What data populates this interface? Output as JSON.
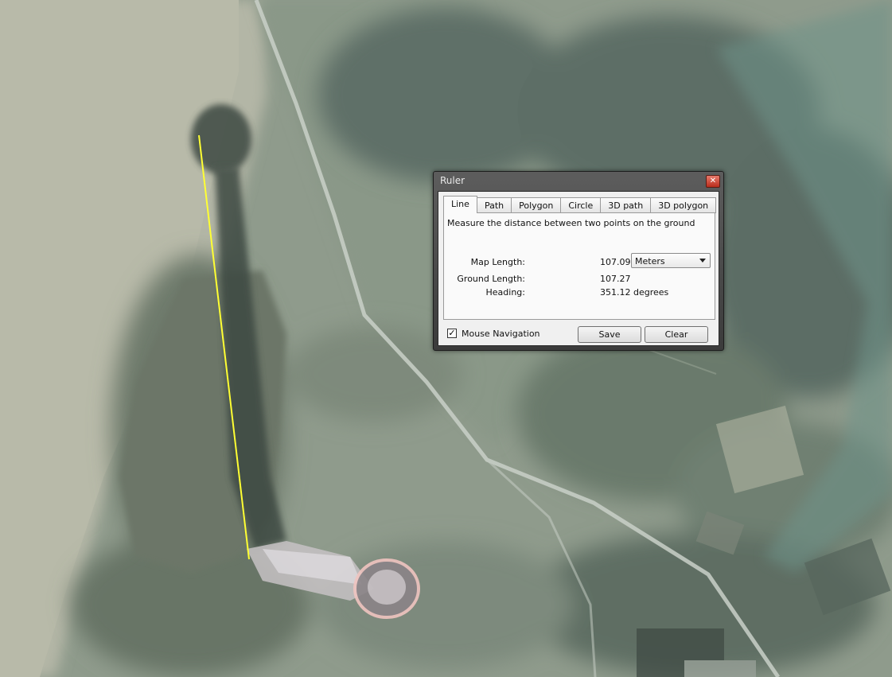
{
  "map": {
    "measure_line_color": "#ffff33",
    "road_color": "#c9d0c8"
  },
  "ruler": {
    "title": "Ruler",
    "close_icon": "close-icon",
    "tabs": [
      {
        "label": "Line",
        "active": true
      },
      {
        "label": "Path",
        "active": false
      },
      {
        "label": "Polygon",
        "active": false
      },
      {
        "label": "Circle",
        "active": false
      },
      {
        "label": "3D path",
        "active": false
      },
      {
        "label": "3D polygon",
        "active": false
      }
    ],
    "description": "Measure the distance between two points on the ground",
    "map_length": {
      "label": "Map Length:",
      "value": "107.09"
    },
    "unit": {
      "selected": "Meters"
    },
    "ground_length": {
      "label": "Ground Length:",
      "value": "107.27"
    },
    "heading": {
      "label": "Heading:",
      "value": "351.12 degrees"
    },
    "mouse_navigation": {
      "label": "Mouse Navigation",
      "checked": true
    },
    "save_label": "Save",
    "clear_label": "Clear"
  }
}
